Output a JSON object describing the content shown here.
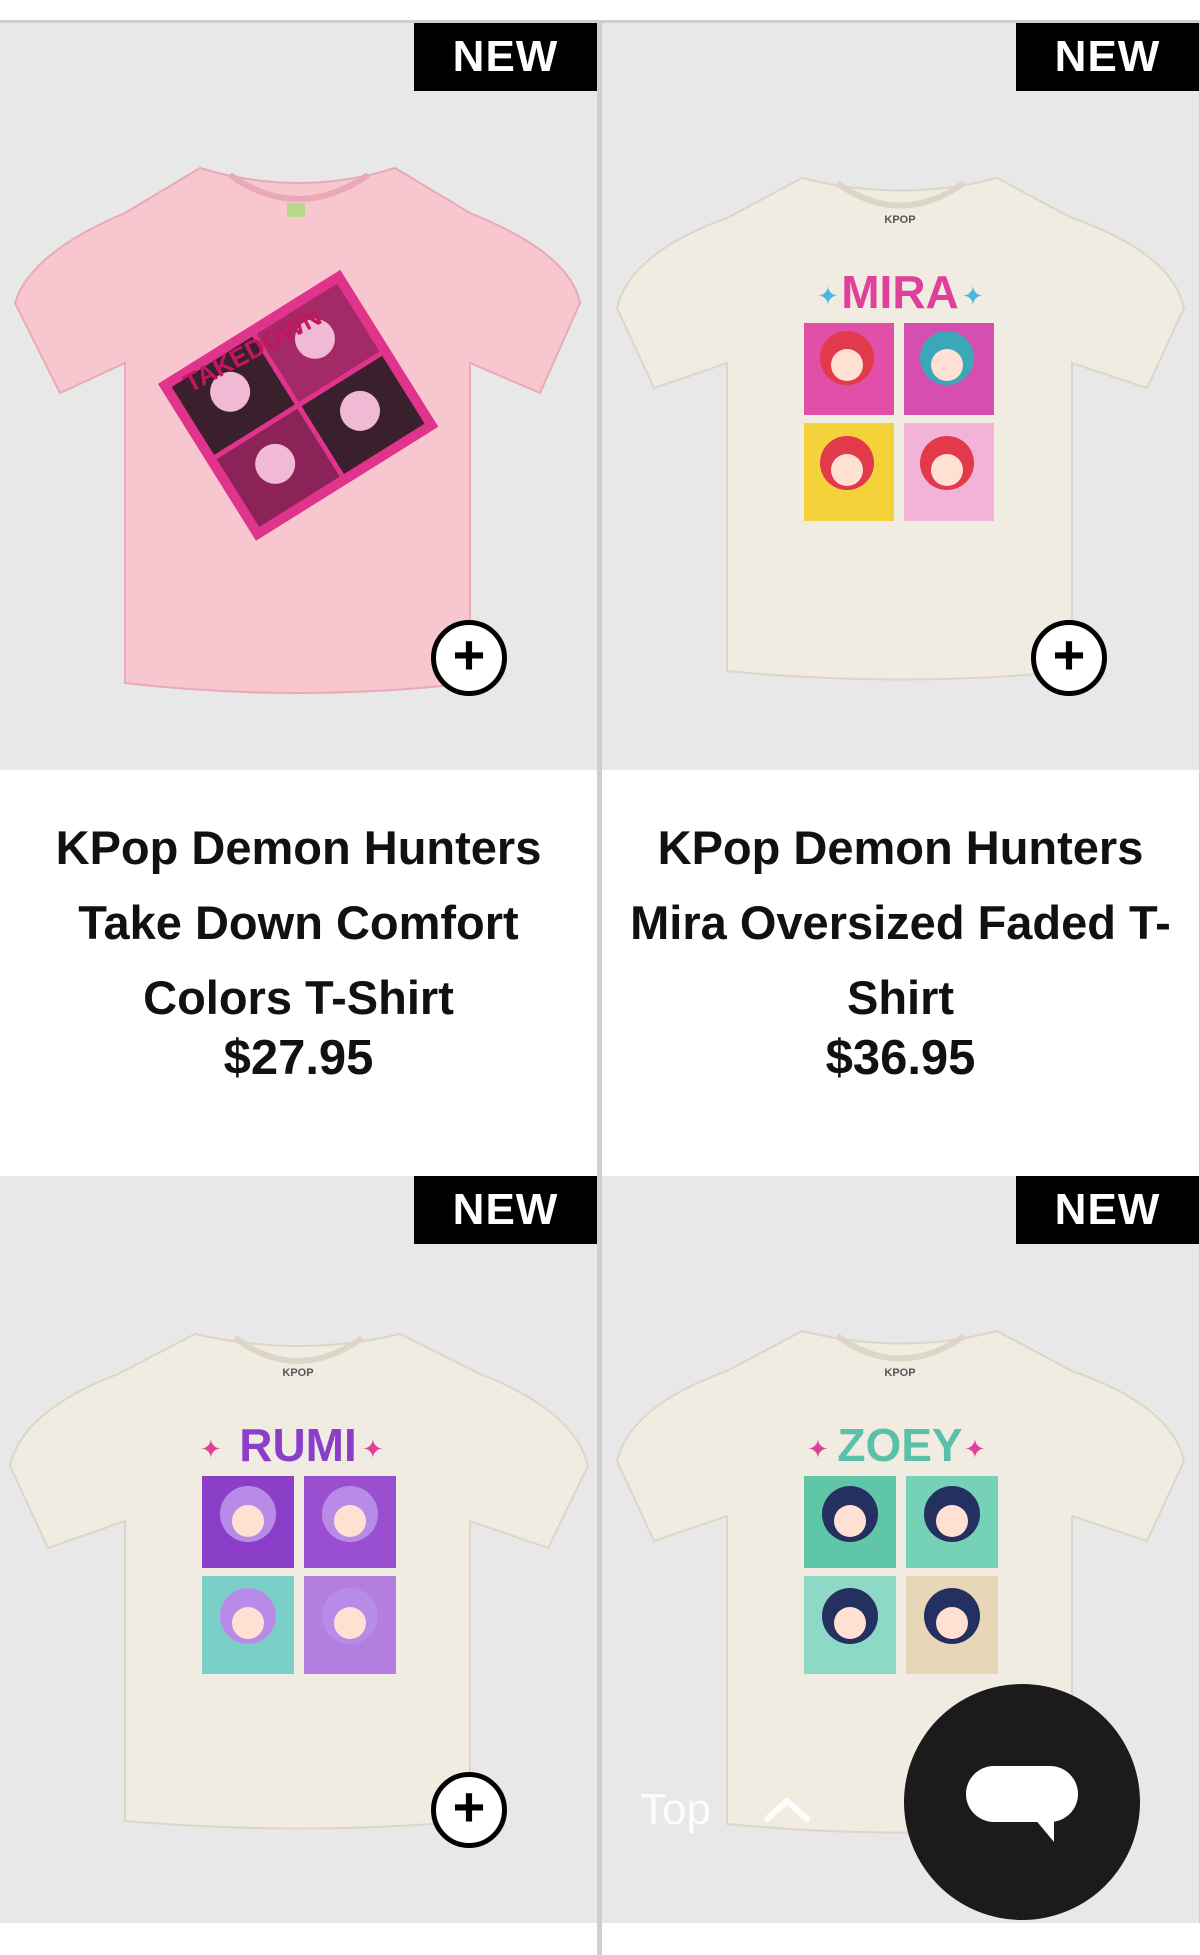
{
  "products": [
    {
      "badge": "NEW",
      "title": "KPop Demon Hunters Take Down Comfort Colors T-Shirt",
      "price": "$27.95",
      "shirt_color": "#f7c6cf",
      "design": "takedown"
    },
    {
      "badge": "NEW",
      "title": "KPop Demon Hunters Mira Oversized Faded T-Shirt",
      "price": "$36.95",
      "shirt_color": "#f1ece2",
      "design": "mira",
      "design_title": "MIRA",
      "label_brand": "KPOP"
    },
    {
      "badge": "NEW",
      "title": "",
      "price": "",
      "shirt_color": "#f1ece2",
      "design": "rumi",
      "design_title": "RUMI",
      "label_brand": "KPOP"
    },
    {
      "badge": "NEW",
      "title": "",
      "price": "",
      "shirt_color": "#f1ece2",
      "design": "zoey",
      "design_title": "ZOEY",
      "label_brand": "KPOP"
    }
  ],
  "scroll_top": {
    "label": "Top",
    "icon": "chevron-up-icon"
  },
  "chat": {
    "icon": "chat-bubble-icon"
  },
  "colors": {
    "badge_bg": "#000000",
    "image_bg": "#e8e8e8",
    "divider": "#cfcfcf"
  }
}
